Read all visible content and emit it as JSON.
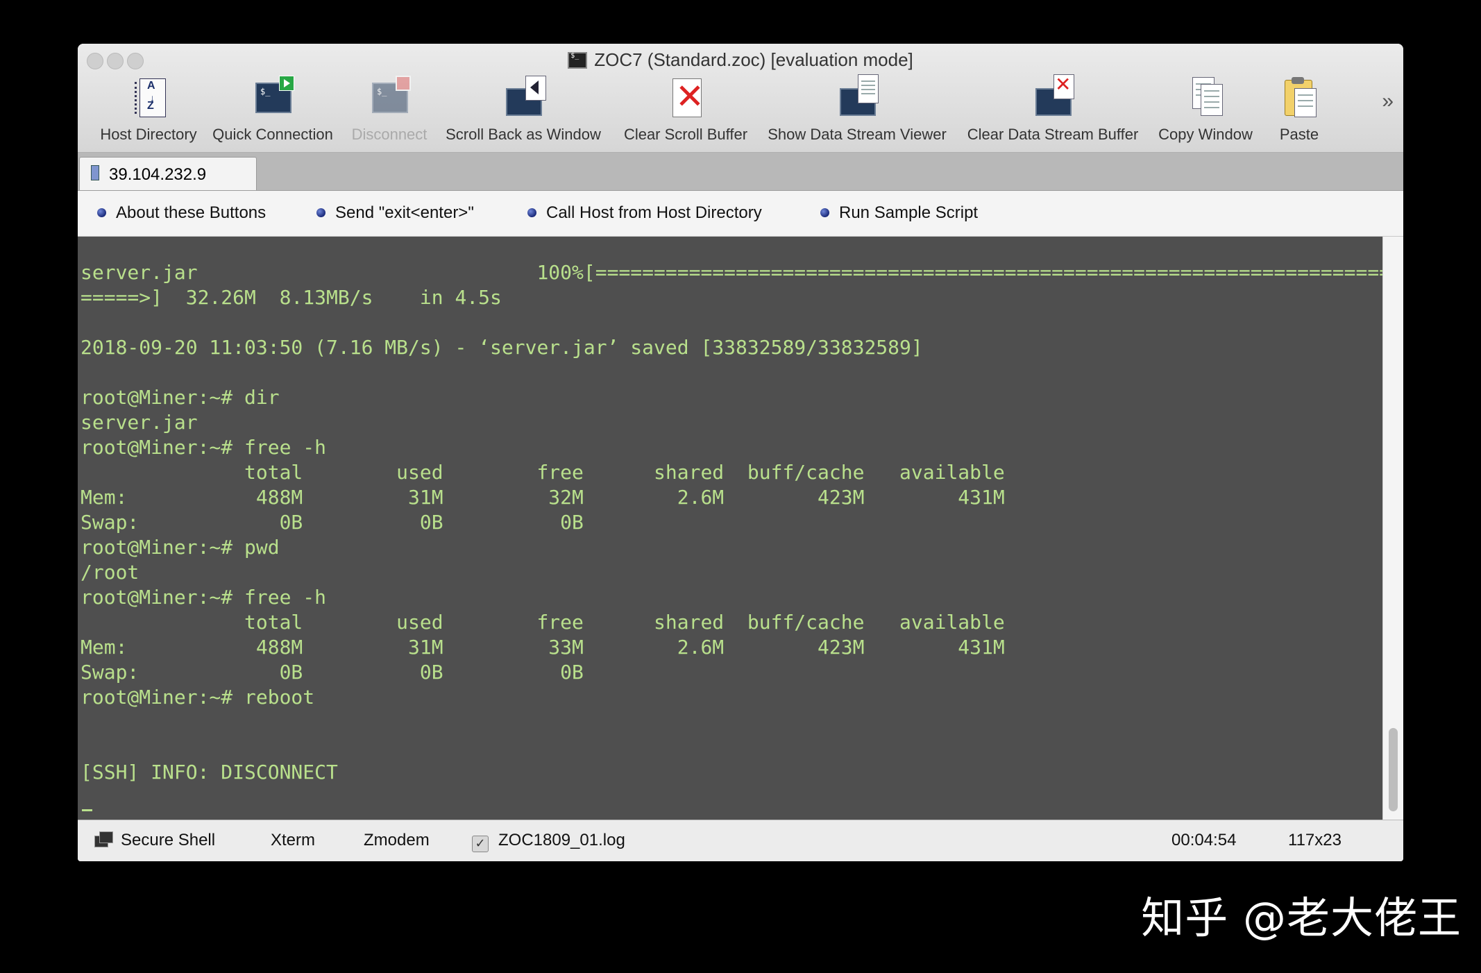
{
  "window": {
    "title": "ZOC7 (Standard.zoc)  [evaluation mode]"
  },
  "toolbar": {
    "buttons": [
      {
        "label": "Host Directory",
        "icon": "host-directory-icon"
      },
      {
        "label": "Quick Connection",
        "icon": "quick-connection-icon"
      },
      {
        "label": "Disconnect",
        "icon": "disconnect-icon",
        "disabled": true
      },
      {
        "label": "Scroll Back as Window",
        "icon": "scroll-back-icon"
      },
      {
        "label": "Clear Scroll Buffer",
        "icon": "clear-scroll-buffer-icon"
      },
      {
        "label": "Show Data Stream Viewer",
        "icon": "data-stream-viewer-icon"
      },
      {
        "label": "Clear Data Stream Buffer",
        "icon": "clear-data-stream-icon"
      },
      {
        "label": "Copy Window",
        "icon": "copy-window-icon"
      },
      {
        "label": "Paste",
        "icon": "paste-icon"
      }
    ],
    "more_label": "»"
  },
  "tabs": [
    {
      "label": "39.104.232.9"
    }
  ],
  "button_bar": [
    {
      "label": "About these Buttons"
    },
    {
      "label": "Send \"exit<enter>\""
    },
    {
      "label": "Call Host from Host Directory"
    },
    {
      "label": "Run Sample Script"
    }
  ],
  "terminal": {
    "text": "server.jar                             100%[=====================================================================================\n=====>]  32.26M  8.13MB/s    in 4.5s\n\n2018-09-20 11:03:50 (7.16 MB/s) - ‘server.jar’ saved [33832589/33832589]\n\nroot@Miner:~# dir\nserver.jar\nroot@Miner:~# free -h\n              total        used        free      shared  buff/cache   available\nMem:           488M         31M         32M        2.6M        423M        431M\nSwap:            0B          0B          0B\nroot@Miner:~# pwd\n/root\nroot@Miner:~# free -h\n              total        used        free      shared  buff/cache   available\nMem:           488M         31M         33M        2.6M        423M        431M\nSwap:            0B          0B          0B\nroot@Miner:~# reboot\n\n\n[SSH] INFO: DISCONNECT",
    "colors": {
      "background": "#4f4f4f",
      "foreground": "#b9e08c"
    }
  },
  "status_bar": {
    "protocol": "Secure Shell",
    "emulation": "Xterm",
    "transfer": "Zmodem",
    "log_checked": true,
    "log_file": "ZOC1809_01.log",
    "check_glyph": "✓",
    "elapsed": "00:04:54",
    "size": "117x23"
  },
  "watermark": "知乎 @老大佬王"
}
